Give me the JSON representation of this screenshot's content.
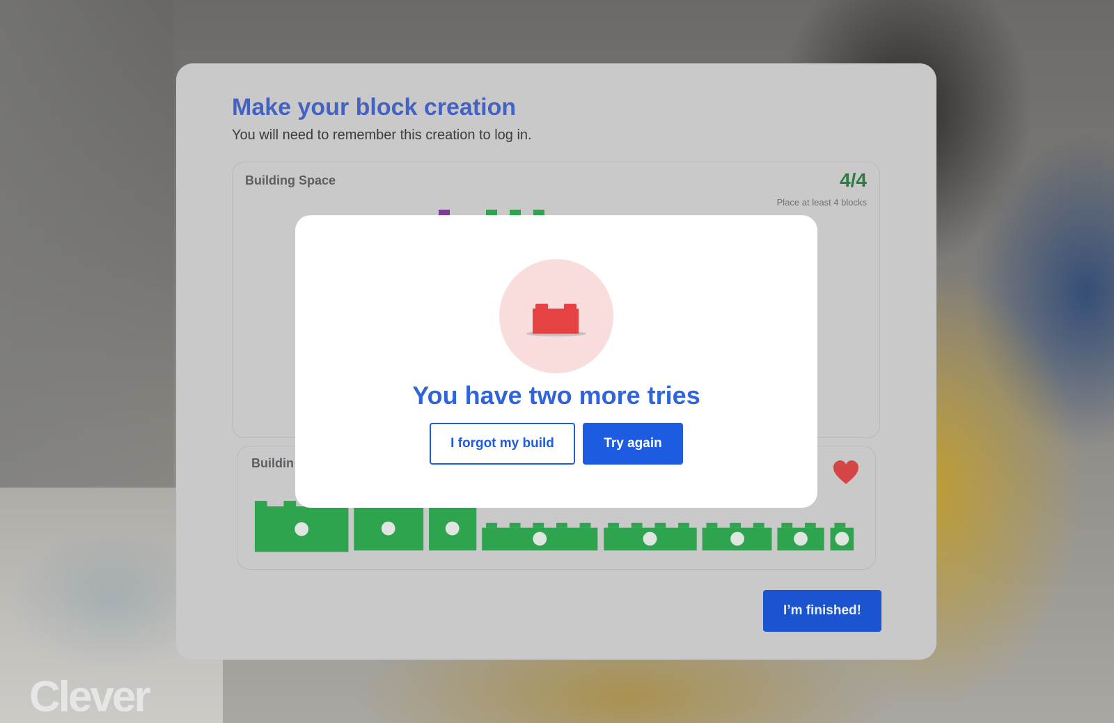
{
  "page": {
    "title": "Make your block creation",
    "subtitle": "You will need to remember this creation to log in."
  },
  "building_space": {
    "label": "Building Space",
    "count": "4/4",
    "hint": "Place at least 4 blocks"
  },
  "block_tray": {
    "label": "Buildin",
    "heart_icon": "heart-icon",
    "block_color": "#2ea44f"
  },
  "finish_button": {
    "label": "I’m finished!"
  },
  "brand": {
    "logo": "Clever"
  },
  "modal": {
    "icon": "brick-icon",
    "icon_color": "#e54343",
    "heading": "You have two more tries",
    "forgot_label": "I forgot my build",
    "retry_label": "Try again"
  },
  "colors": {
    "accent": "#1d5ce0",
    "title": "#4462c2",
    "success": "#2d7a43",
    "block": "#2ea44f",
    "error": "#e54343"
  }
}
